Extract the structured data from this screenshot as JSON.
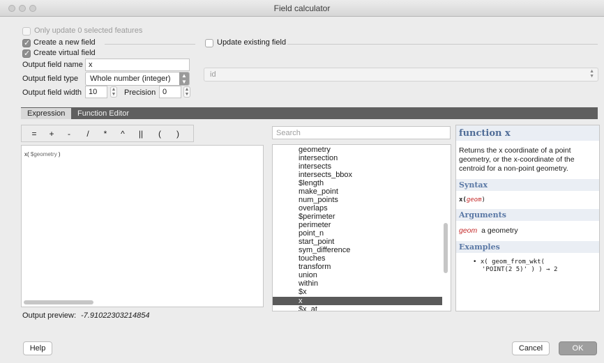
{
  "window": {
    "title": "Field calculator"
  },
  "options": {
    "only_update": "Only update 0 selected features",
    "create_new": "Create a new field",
    "create_virtual": "Create virtual field",
    "update_existing": "Update existing field",
    "output_name_label": "Output field name",
    "output_name_value": "x",
    "output_type_label": "Output field type",
    "output_type_value": "Whole number (integer)",
    "output_width_label": "Output field width",
    "output_width_value": "10",
    "precision_label": "Precision",
    "precision_value": "0",
    "existing_field_value": "id"
  },
  "tabs": [
    {
      "label": "Expression"
    },
    {
      "label": "Function Editor"
    }
  ],
  "operators": [
    "=",
    "+",
    "-",
    "/",
    "*",
    "^",
    "||",
    "(",
    ")"
  ],
  "editor": {
    "fn": "x(",
    "arg": " $geometry ",
    "close": ")"
  },
  "search": {
    "placeholder": "Search"
  },
  "function_list": [
    "geometry",
    "intersection",
    "intersects",
    "intersects_bbox",
    "$length",
    "make_point",
    "num_points",
    "overlaps",
    "$perimeter",
    "perimeter",
    "point_n",
    "start_point",
    "sym_difference",
    "touches",
    "transform",
    "union",
    "within",
    "$x",
    "x",
    "$x_at"
  ],
  "selected_function": "x",
  "help": {
    "title": "function x",
    "description": "Returns the x coordinate of a point geometry, or the x-coordinate of the centroid for a non-point geometry.",
    "syntax_heading": "Syntax",
    "syntax_fn": "x(",
    "syntax_arg": "geom",
    "syntax_close": ")",
    "arguments_heading": "Arguments",
    "arg_name": "geom",
    "arg_desc": "a geometry",
    "examples_heading": "Examples",
    "example_line1": "x( geom_from_wkt(",
    "example_line2": "'POINT(2 5)' ) ) → 2"
  },
  "preview": {
    "label": "Output preview:",
    "value": "-7.91022303214854"
  },
  "buttons": {
    "help": "Help",
    "cancel": "Cancel",
    "ok": "OK"
  }
}
